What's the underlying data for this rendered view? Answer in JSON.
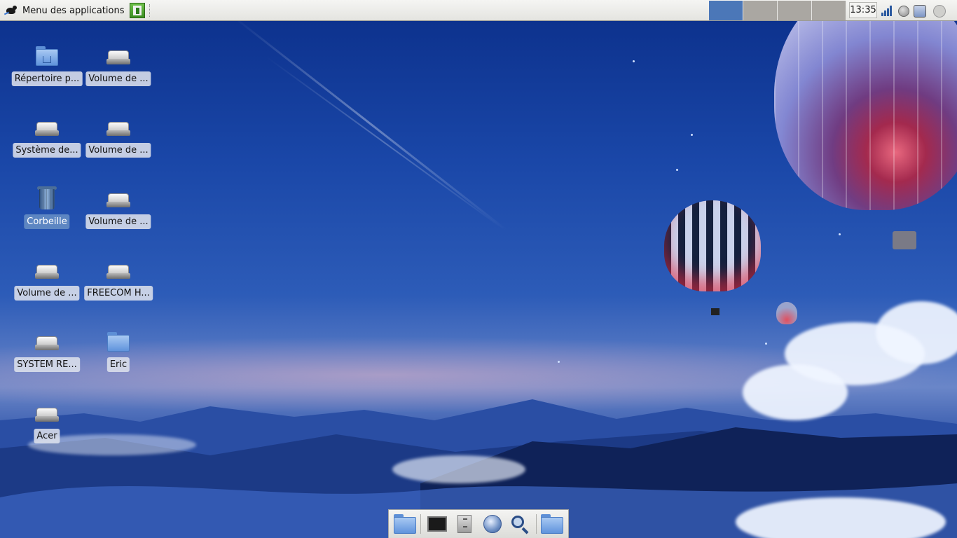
{
  "top_panel": {
    "menu_label": "Menu des applications",
    "clock": "13:35",
    "workspaces": [
      {
        "active": true
      },
      {
        "active": false
      },
      {
        "active": false
      },
      {
        "active": false
      }
    ],
    "tray_icons": [
      "network-signal-icon",
      "update-globe-icon",
      "battery-icon",
      "power-icon"
    ]
  },
  "desktop": {
    "icons": [
      {
        "label": "Répertoire p...",
        "icon": "home-folder-icon"
      },
      {
        "label": "Volume de ...",
        "icon": "drive-icon"
      },
      {
        "label": "Système de...",
        "icon": "drive-icon"
      },
      {
        "label": "Volume de ...",
        "icon": "drive-icon"
      },
      {
        "label": "Corbeille",
        "icon": "trash-icon"
      },
      {
        "label": "Volume de ...",
        "icon": "drive-icon"
      },
      {
        "label": "Volume de ...",
        "icon": "drive-icon"
      },
      {
        "label": "FREECOM H...",
        "icon": "drive-icon"
      },
      {
        "label": "SYSTEM RE...",
        "icon": "drive-icon"
      },
      {
        "label": "Eric",
        "icon": "folder-icon"
      },
      {
        "label": "Acer",
        "icon": "drive-icon"
      }
    ]
  },
  "dock": {
    "items": [
      "show-desktop-icon",
      "terminal-icon",
      "file-cabinet-icon",
      "web-browser-icon",
      "search-icon",
      "folder-icon"
    ]
  },
  "colors": {
    "workspace_active": "#4b77b8",
    "workspace_inactive": "#aaa7a2",
    "selected_label": "#5d86c2"
  }
}
